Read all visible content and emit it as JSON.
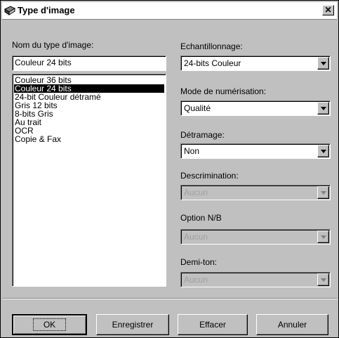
{
  "window": {
    "title": "Type d'image",
    "close_glyph": "✕"
  },
  "left": {
    "name_label": "Nom du type d'image:",
    "name_value": "Couleur 24 bits",
    "items": [
      "Couleur 36 bits",
      "Couleur 24 bits",
      "24-bit Couleur détramé",
      "Gris 12 bits",
      "8-bits Gris",
      "Au trait",
      "OCR",
      "Copie & Fax"
    ],
    "selected_index": 1
  },
  "right": {
    "sampling": {
      "label": "Echantillonnage:",
      "value": "24-bits Couleur"
    },
    "scan_mode": {
      "label": "Mode de numérisation:",
      "value": "Qualité"
    },
    "descreening": {
      "label": "Détramage:",
      "value": "Non"
    },
    "discrimination": {
      "label": "Descrimination:",
      "value": "Aucun"
    },
    "option_nb": {
      "label": "Option N/B",
      "value": "Aucun"
    },
    "halftone": {
      "label": "Demi-ton:",
      "value": "Aucun"
    }
  },
  "buttons": {
    "ok": "OK",
    "save": "Enregistrer",
    "delete": "Effacer",
    "cancel": "Annuler"
  },
  "colors": {
    "face": "#c0c0c0",
    "selection": "#000000"
  }
}
